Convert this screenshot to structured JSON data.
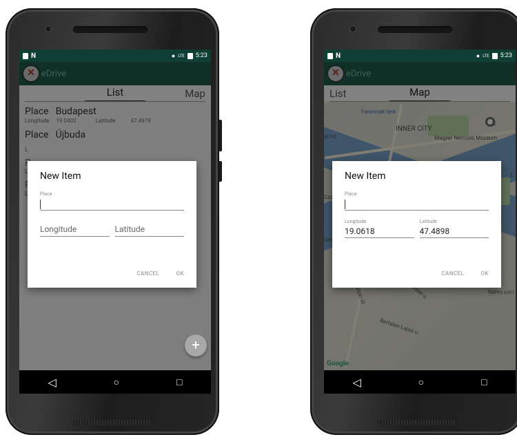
{
  "status_bar": {
    "time": "5:23",
    "signal": "LTE"
  },
  "app": {
    "title": "eDrive"
  },
  "tabs": {
    "list": "List",
    "map": "Map"
  },
  "list_rows": [
    {
      "place_label": "Place",
      "place": "Budapest",
      "lon_label": "Longitude",
      "lon": "19.0402",
      "lat_label": "Latitude",
      "lat": "47.4979"
    },
    {
      "place_label": "Place",
      "place": "Újbuda"
    }
  ],
  "list_hidden_letters": [
    "L",
    "P",
    "L",
    "P",
    "L"
  ],
  "fab": {
    "icon": "plus-icon",
    "label": "+"
  },
  "nav": {
    "back": "◁",
    "home": "○",
    "recents": "□"
  },
  "dialog_left": {
    "title": "New Item",
    "place_label": "Place",
    "longitude_placeholder": "Longitude",
    "latitude_placeholder": "Latitude",
    "cancel": "CANCEL",
    "ok": "OK"
  },
  "dialog_right": {
    "title": "New Item",
    "place_label": "Place",
    "longitude_label": "Longitude",
    "latitude_label": "Latitude",
    "longitude_value": "19.0618",
    "latitude_value": "47.4898",
    "cancel": "CANCEL",
    "ok": "OK"
  },
  "map_labels": {
    "inner_city": "INNER CITY",
    "ferenciek": "Ferenciek tere",
    "museum": "Magyar Nemzeti Múzeum",
    "park": "Nehru part",
    "google": "Google",
    "street1": "Bertalan Lajos u.",
    "street2": "Budafoki út",
    "szabad": "Sza",
    "gellert": "Gell",
    "hd": "ét hd",
    "street3": "Mester u.",
    "fe": "F",
    "e": "E"
  },
  "colors": {
    "statusbar": "#0f3f34",
    "appbar": "#1e5a4b",
    "accent": "#6fbfa5"
  }
}
